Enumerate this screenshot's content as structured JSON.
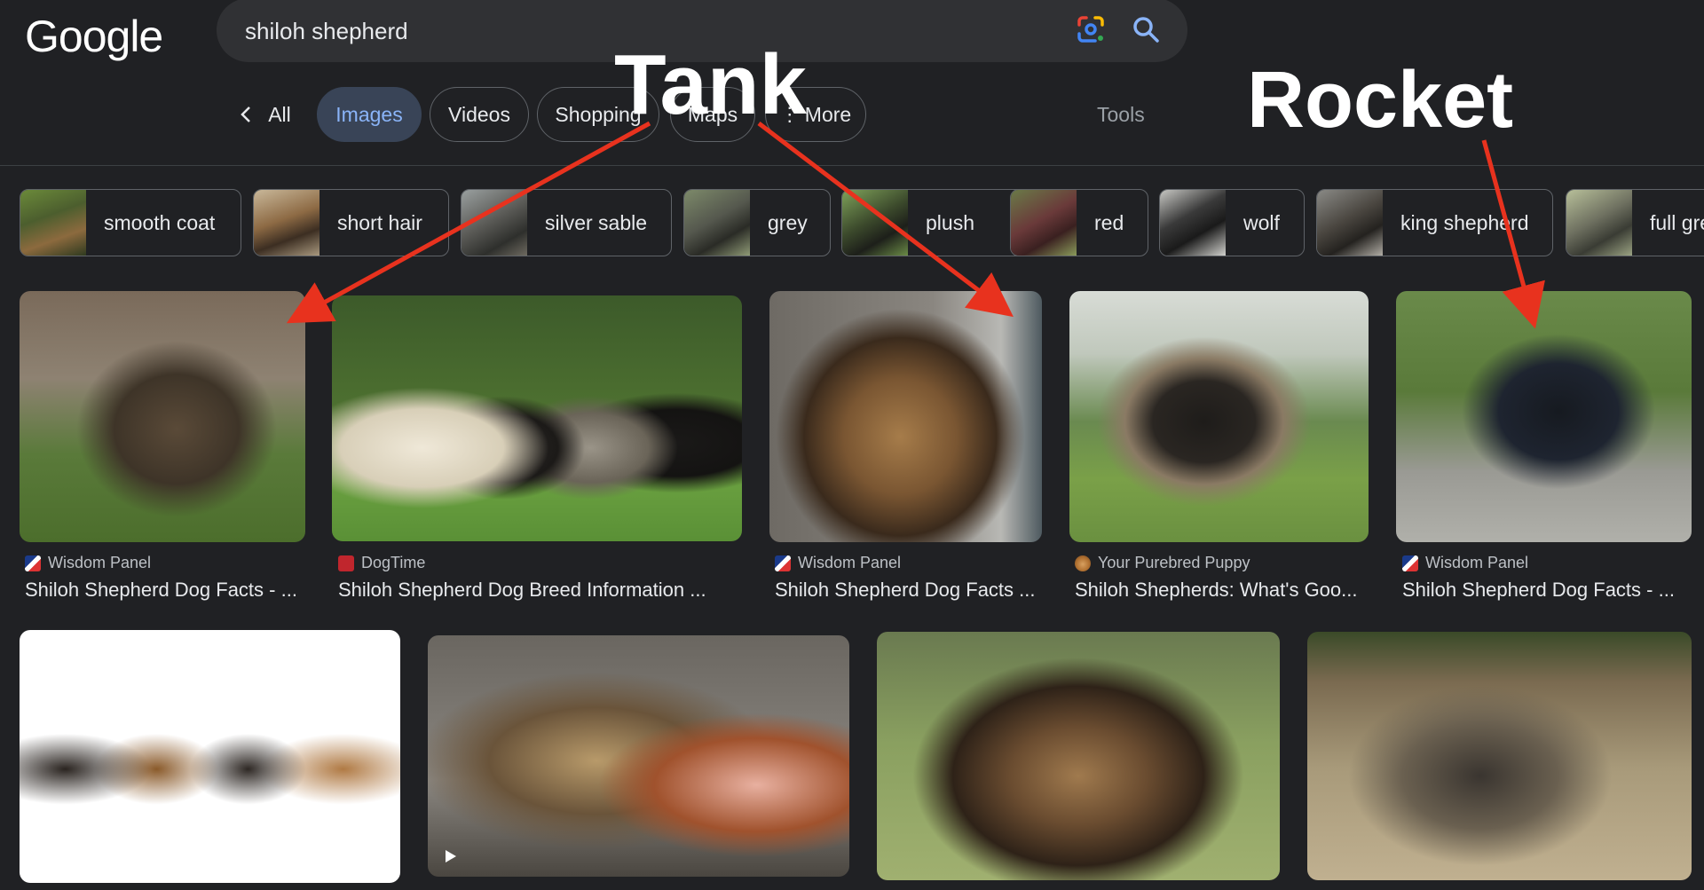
{
  "header": {
    "logo": "Google",
    "search_value": "shiloh shepherd"
  },
  "tabs": [
    {
      "label": "All",
      "active": false,
      "icon": "chevron-left-icon"
    },
    {
      "label": "Images",
      "active": true
    },
    {
      "label": "Videos",
      "active": false
    },
    {
      "label": "Shopping",
      "active": false
    },
    {
      "label": "Maps",
      "active": false
    },
    {
      "label": "More",
      "active": false,
      "icon": "vertical-dots-icon"
    }
  ],
  "tools_label": "Tools",
  "chips": [
    {
      "label": "smooth coat"
    },
    {
      "label": "short hair"
    },
    {
      "label": "silver sable"
    },
    {
      "label": "grey"
    },
    {
      "label": "plush"
    },
    {
      "label": "red"
    },
    {
      "label": "wolf"
    },
    {
      "label": "king shepherd"
    },
    {
      "label": "full grey"
    }
  ],
  "results_row1": [
    {
      "source": "Wisdom Panel",
      "title": "Shiloh Shepherd Dog Facts - ..."
    },
    {
      "source": "DogTime",
      "title": "Shiloh Shepherd Dog Breed Information ..."
    },
    {
      "source": "Wisdom Panel",
      "title": "Shiloh Shepherd Dog Facts ..."
    },
    {
      "source": "Your Purebred Puppy",
      "title": "Shiloh Shepherds: What's Goo..."
    },
    {
      "source": "Wisdom Panel",
      "title": "Shiloh Shepherd Dog Facts - ..."
    }
  ],
  "annotations": {
    "tank": "Tank",
    "rocket": "Rocket"
  },
  "colors": {
    "background": "#202124",
    "active_tab_bg": "#394457",
    "active_tab_text": "#8ab4f8",
    "arrow": "#e8321e"
  }
}
